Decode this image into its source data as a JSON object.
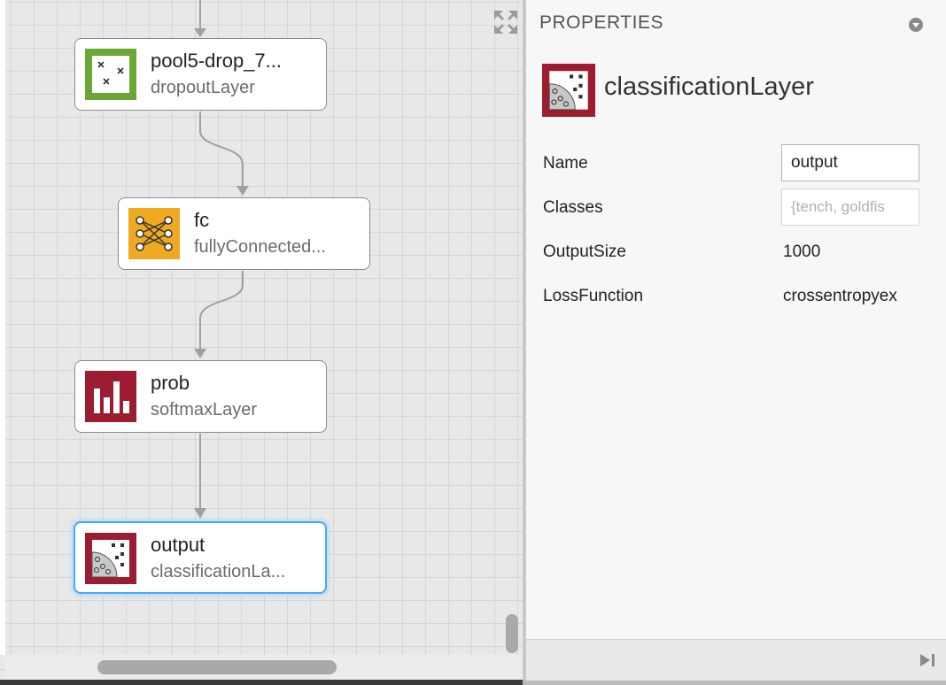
{
  "canvas": {
    "nodes": [
      {
        "name": "pool5-drop_7...",
        "type": "dropoutLayer",
        "icon": "dropout-icon",
        "color": "#6aa833"
      },
      {
        "name": "fc",
        "type": "fullyConnected...",
        "icon": "fully-connected-icon",
        "color": "#efaa22"
      },
      {
        "name": "prob",
        "type": "softmaxLayer",
        "icon": "softmax-icon",
        "color": "#9c1c31"
      },
      {
        "name": "output",
        "type": "classificationLa...",
        "icon": "classification-icon",
        "color": "#9c1c31",
        "selected": true
      }
    ],
    "connector_color": "#a0a0a0",
    "selection_color": "#49a9f2"
  },
  "properties": {
    "title": "PROPERTIES",
    "layer_type": "classificationLayer",
    "rows": [
      {
        "label": "Name",
        "value": "output",
        "kind": "input"
      },
      {
        "label": "Classes",
        "value": "{tench, goldfis",
        "kind": "input-disabled"
      },
      {
        "label": "OutputSize",
        "value": "1000",
        "kind": "text"
      },
      {
        "label": "LossFunction",
        "value": "crossentropyex",
        "kind": "text"
      }
    ]
  }
}
